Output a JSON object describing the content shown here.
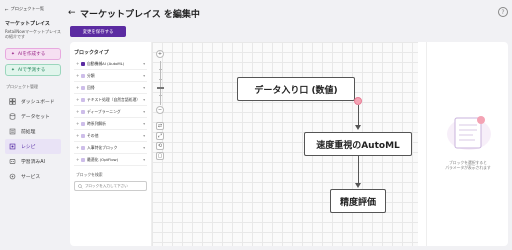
{
  "sidebar": {
    "back_label": "プロジェクト一覧",
    "project_name": "マーケットプレイス",
    "project_desc": "RetailNowマーケットプレイスの紹介です",
    "ai_create_label": "AIを作成する",
    "ai_predict_label": "AIで予測する",
    "section_label": "プロジェクト管理",
    "nav_items": [
      {
        "label": "ダッシュボード",
        "icon": "dashboard-icon"
      },
      {
        "label": "データセット",
        "icon": "dataset-icon"
      },
      {
        "label": "前処理",
        "icon": "preprocess-icon"
      },
      {
        "label": "レシピ",
        "icon": "recipe-icon",
        "active": true
      },
      {
        "label": "学習済みAI",
        "icon": "trained-ai-icon"
      },
      {
        "label": "サービス",
        "icon": "service-icon"
      }
    ]
  },
  "header": {
    "back_glyph": "←",
    "title": "マーケットプレイス を編集中",
    "help_glyph": "?",
    "save_label": "変更を保存する"
  },
  "block_panel": {
    "title": "ブロックタイプ",
    "items": [
      {
        "label": "自動機械AI (AutoML)",
        "color": "#5b2ba1"
      },
      {
        "label": "分類"
      },
      {
        "label": "回帰"
      },
      {
        "label": "テキスト処理（自然言語処理）"
      },
      {
        "label": "ディープラーニング"
      },
      {
        "label": "時系列解析"
      },
      {
        "label": "その他"
      },
      {
        "label": "入事特化ブロック"
      },
      {
        "label": "最適化 (OptFlow)"
      }
    ],
    "search_label": "ブロックを検索",
    "search_placeholder": "ブロックを入力して下さい"
  },
  "canvas": {
    "nodes": [
      {
        "label": "データ入り口 (数値)"
      },
      {
        "label": "速度重視のAutoML"
      },
      {
        "label": "精度評価"
      }
    ],
    "zoom_in_glyph": "+",
    "zoom_out_glyph": "−",
    "tools": [
      "⇄",
      "⤢",
      "⟲",
      "▢"
    ]
  },
  "props": {
    "message": "ブロックを選択すると\nパラメータが表示されます"
  },
  "colors": {
    "accent": "#5b2ba1",
    "port": "#f4a3b4"
  }
}
